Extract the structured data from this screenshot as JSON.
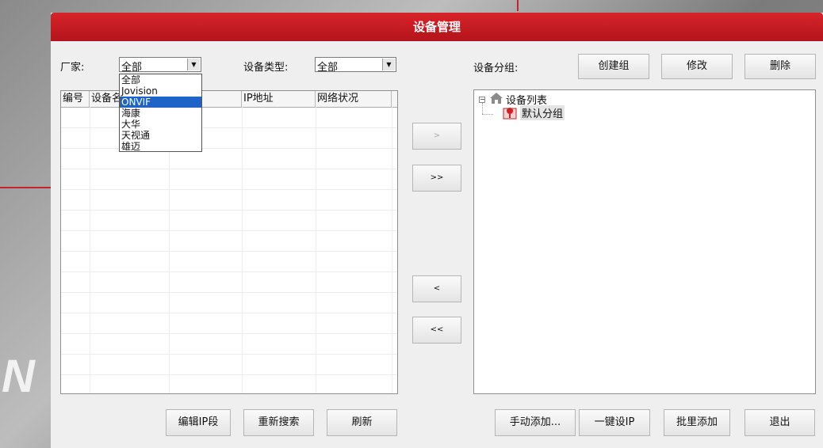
{
  "dialog": {
    "title": "设备管理"
  },
  "filters": {
    "vendor_label": "厂家:",
    "vendor_value": "全部",
    "type_label": "设备类型:",
    "type_value": "全部"
  },
  "vendor_dropdown": {
    "options": [
      "全部",
      "Jovision",
      "ONVIF",
      "海康",
      "大华",
      "天视通",
      "雄迈"
    ],
    "highlighted": "ONVIF"
  },
  "table": {
    "columns": [
      "编号",
      "设备名",
      "",
      "IP地址",
      "网络状况"
    ]
  },
  "transfer": {
    "add_one": ">",
    "add_all": ">>",
    "remove_one": "<",
    "remove_all": "<<"
  },
  "groups": {
    "label": "设备分组:",
    "create_label": "创建组",
    "edit_label": "修改",
    "delete_label": "删除",
    "tree_root": "设备列表",
    "tree_child": "默认分组"
  },
  "bottom_left": {
    "edit_ip_label": "编辑IP段",
    "research_label": "重新搜索",
    "refresh_label": "刷新"
  },
  "bottom_right": {
    "manual_add_label": "手动添加...",
    "one_key_ip_label": "一键设IP",
    "batch_add_label": "批里添加",
    "exit_label": "退出"
  },
  "colors": {
    "title_red": "#c61c22",
    "selection_blue": "#1e64c8"
  },
  "icons": {
    "tree_root": "home-icon",
    "tree_child": "group-pin-icon"
  }
}
